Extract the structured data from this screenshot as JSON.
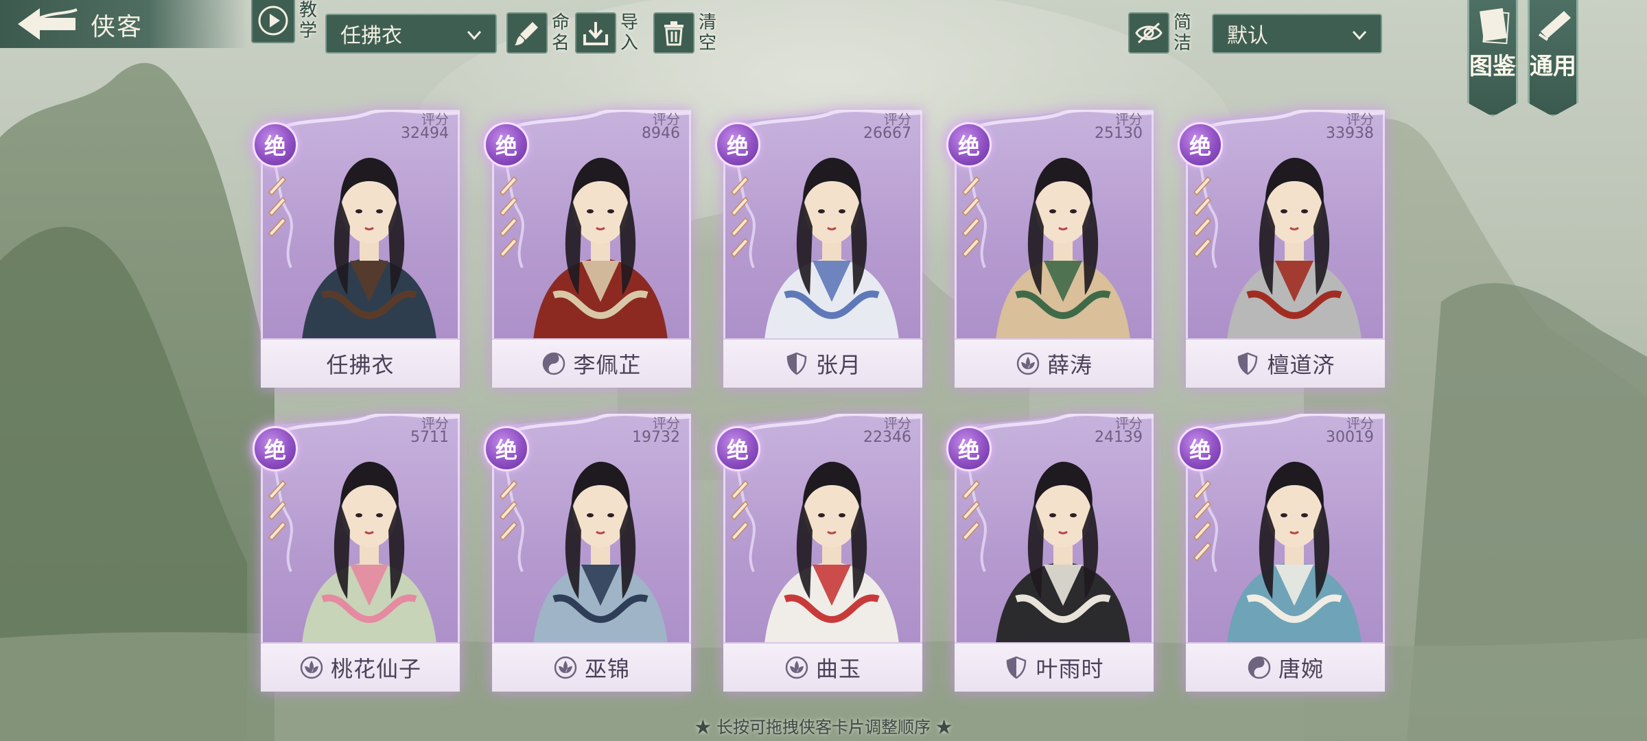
{
  "header": {
    "title": "侠客",
    "tutorial": {
      "icon": "play-icon",
      "label": "教学"
    },
    "character_select": "任拂衣",
    "rename": {
      "icon": "brush-icon",
      "label": "命名"
    },
    "import": {
      "icon": "import-icon",
      "label": "导入"
    },
    "clear": {
      "icon": "trash-icon",
      "label": "清空"
    },
    "simple": {
      "icon": "eye-off-icon",
      "label": "简洁"
    },
    "sort_select": "默认"
  },
  "side_tabs": [
    {
      "icon": "book-icon",
      "label": "图鉴"
    },
    {
      "icon": "scroll-icon",
      "label": "通用"
    }
  ],
  "score_label": "评分",
  "rank_label": "绝",
  "cards": [
    {
      "name": "任拂衣",
      "score": "32494",
      "sect_icon": "",
      "portrait_color": "#2f3e4e",
      "accent": "#5a3b2a",
      "stars": 3
    },
    {
      "name": "李佩芷",
      "score": "8946",
      "sect_icon": "yinyang-icon",
      "portrait_color": "#8c2a22",
      "accent": "#d9c8a8",
      "stars": 4
    },
    {
      "name": "张月",
      "score": "26667",
      "sect_icon": "shield-icon",
      "portrait_color": "#e8eaf2",
      "accent": "#5f79b8",
      "stars": 4
    },
    {
      "name": "薛涛",
      "score": "25130",
      "sect_icon": "lotus-icon",
      "portrait_color": "#d9bf9a",
      "accent": "#3f6a48",
      "stars": 4
    },
    {
      "name": "檀道济",
      "score": "33938",
      "sect_icon": "shield-icon",
      "portrait_color": "#b8b8b8",
      "accent": "#a12d22",
      "stars": 4
    },
    {
      "name": "桃花仙子",
      "score": "5711",
      "sect_icon": "lotus-icon",
      "portrait_color": "#c8d4b8",
      "accent": "#e58aa0",
      "stars": 3
    },
    {
      "name": "巫锦",
      "score": "19732",
      "sect_icon": "lotus-icon",
      "portrait_color": "#9fb4c6",
      "accent": "#2e3e56",
      "stars": 3
    },
    {
      "name": "曲玉",
      "score": "22346",
      "sect_icon": "lotus-icon",
      "portrait_color": "#f0ede8",
      "accent": "#c83a3a",
      "stars": 3
    },
    {
      "name": "叶雨时",
      "score": "24139",
      "sect_icon": "shield-icon",
      "portrait_color": "#2b2b2e",
      "accent": "#e8e4da",
      "stars": 3
    },
    {
      "name": "唐婉",
      "score": "30019",
      "sect_icon": "yinyang-icon",
      "portrait_color": "#6fa3b8",
      "accent": "#f0ede4",
      "stars": 4
    }
  ],
  "hint": "★ 长按可拖拽侠客卡片调整顺序 ★"
}
